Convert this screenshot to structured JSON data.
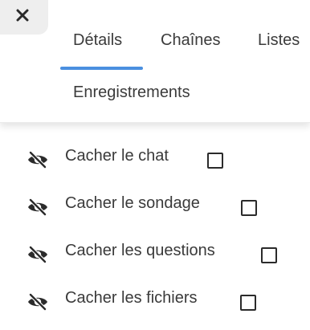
{
  "header": {
    "close_icon": "close-icon",
    "tabs": [
      {
        "label": "Détails",
        "active": true
      },
      {
        "label": "Chaînes",
        "active": false
      },
      {
        "label": "Listes",
        "active": false
      },
      {
        "label": "Enregistrements",
        "active": false
      }
    ],
    "accent_color": "#4a8fe0"
  },
  "options": [
    {
      "label": "Cacher le chat",
      "checked": false,
      "icon": "eye-slash-icon"
    },
    {
      "label": "Cacher le sondage",
      "checked": false,
      "icon": "eye-slash-icon"
    },
    {
      "label": "Cacher les questions",
      "checked": false,
      "icon": "eye-slash-icon"
    },
    {
      "label": "Cacher les fichiers",
      "checked": false,
      "icon": "eye-slash-icon"
    }
  ]
}
